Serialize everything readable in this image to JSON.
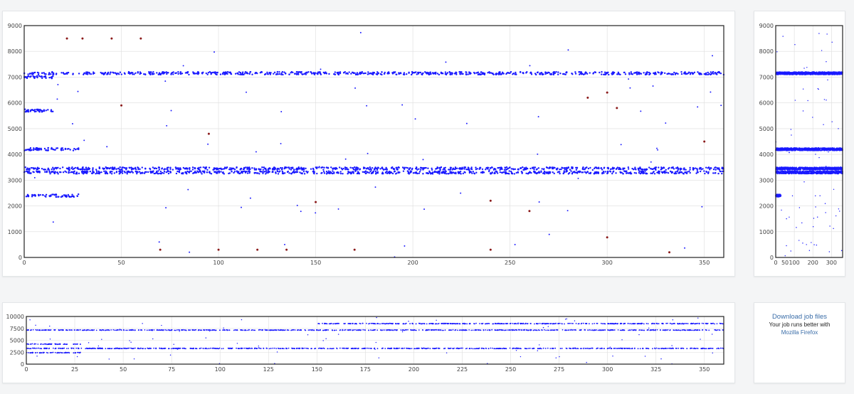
{
  "colors": {
    "primary_dot": "#1a1aff",
    "secondary_dot": "#8b1a1a",
    "grid": "#dddddd",
    "link": "#3a6da8"
  },
  "download": {
    "title": "Download job files",
    "subtitle": "Your job runs better with",
    "link": "Mozilla Firefox"
  },
  "chart_data": [
    {
      "name": "main-scatter",
      "type": "scatter",
      "xlim": [
        0,
        360
      ],
      "ylim": [
        0,
        9000
      ],
      "xticks": [
        0,
        50,
        100,
        150,
        200,
        250,
        300,
        350
      ],
      "yticks": [
        0,
        1000,
        2000,
        3000,
        4000,
        5000,
        6000,
        7000,
        8000,
        9000
      ],
      "grid": true,
      "series": [
        {
          "color": "#1a1aff",
          "bands": [
            [
              0,
              360,
              7150
            ],
            [
              0,
              360,
              3300
            ],
            [
              0,
              360,
              3450
            ],
            [
              0,
              28,
              2400
            ],
            [
              0,
              28,
              4200
            ],
            [
              0,
              15,
              7000
            ],
            [
              0,
              15,
              5700
            ]
          ]
        },
        {
          "color": "#8b1a1a",
          "points": [
            [
              22,
              8500
            ],
            [
              30,
              8500
            ],
            [
              45,
              8500
            ],
            [
              60,
              8500
            ],
            [
              70,
              300
            ],
            [
              100,
              300
            ],
            [
              120,
              300
            ],
            [
              135,
              300
            ],
            [
              170,
              300
            ],
            [
              240,
              300
            ],
            [
              300,
              780
            ],
            [
              332,
              200
            ],
            [
              290,
              6200
            ],
            [
              300,
              6400
            ],
            [
              305,
              5800
            ],
            [
              240,
              2200
            ],
            [
              260,
              1800
            ],
            [
              150,
              2150
            ],
            [
              95,
              4800
            ],
            [
              50,
              5900
            ],
            [
              350,
              4500
            ]
          ]
        }
      ]
    },
    {
      "name": "side-scatter",
      "type": "scatter",
      "xlim": [
        0,
        360
      ],
      "ylim": [
        0,
        9000
      ],
      "xticks": [
        0,
        100,
        200,
        300
      ],
      "xticklabels": [
        "0",
        "100",
        "200",
        "300"
      ],
      "yticks": [
        0,
        1000,
        2000,
        3000,
        4000,
        5000,
        6000,
        7000,
        8000,
        9000
      ],
      "extra_xtick": {
        "value": 50,
        "label": "50"
      },
      "grid": true,
      "series": [
        {
          "color": "#1a1aff",
          "bands": [
            [
              0,
              360,
              7150
            ],
            [
              0,
              360,
              3300
            ],
            [
              0,
              360,
              3450
            ],
            [
              0,
              360,
              4200
            ],
            [
              0,
              28,
              2400
            ]
          ]
        }
      ]
    },
    {
      "name": "overview-scatter",
      "type": "scatter",
      "xlim": [
        0,
        360
      ],
      "ylim": [
        0,
        10000
      ],
      "xticks": [
        0,
        25,
        50,
        75,
        100,
        125,
        150,
        175,
        200,
        225,
        250,
        275,
        300,
        325,
        350
      ],
      "yticks": [
        0,
        2500,
        5000,
        7500,
        10000
      ],
      "grid": true,
      "series": [
        {
          "color": "#1a1aff",
          "bands": [
            [
              0,
              360,
              7150
            ],
            [
              0,
              360,
              3300
            ],
            [
              0,
              28,
              4200
            ],
            [
              0,
              28,
              2400
            ],
            [
              150,
              360,
              8500
            ]
          ]
        }
      ]
    }
  ]
}
